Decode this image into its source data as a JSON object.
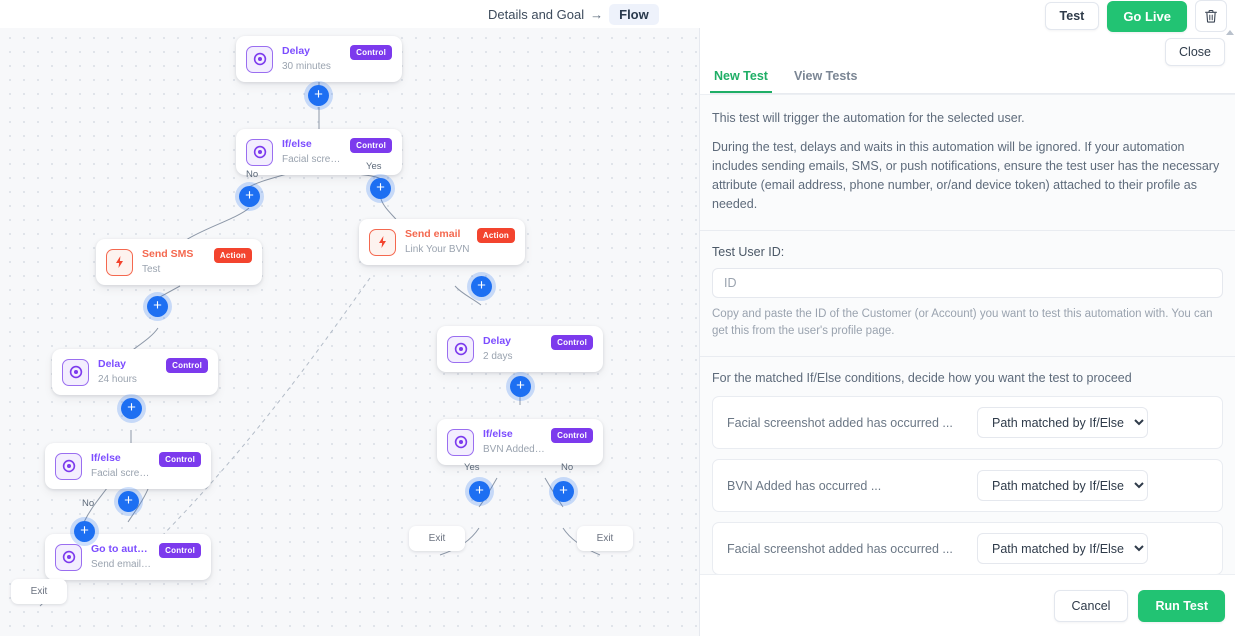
{
  "header": {
    "breadcrumb_first": "Details and Goal",
    "breadcrumb_arrow": "→",
    "breadcrumb_active": "Flow",
    "test_label": "Test",
    "go_live_label": "Go Live",
    "trash_icon": "trash-icon"
  },
  "canvas": {
    "nodes": [
      {
        "title": "Delay",
        "sub": "30 minutes",
        "badge": "Control",
        "kind": "control"
      },
      {
        "title": "If/else",
        "sub": "Facial screenshot added has ...",
        "badge": "Control",
        "kind": "control"
      },
      {
        "title": "Send SMS",
        "sub": "Test",
        "badge": "Action",
        "kind": "action"
      },
      {
        "title": "Send email",
        "sub": "Link Your BVN",
        "badge": "Action",
        "kind": "action"
      },
      {
        "title": "Delay",
        "sub": "24 hours",
        "badge": "Control",
        "kind": "control"
      },
      {
        "title": "If/else",
        "sub": "Facial screenshot added has ...",
        "badge": "Control",
        "kind": "control"
      },
      {
        "title": "Go to automation ...",
        "sub": "Send email ⇒ Link Your BVN",
        "badge": "Control",
        "kind": "control"
      },
      {
        "title": "Delay",
        "sub": "2 days",
        "badge": "Control",
        "kind": "control"
      },
      {
        "title": "If/else",
        "sub": "BVN Added has occurred ...",
        "badge": "Control",
        "kind": "control"
      }
    ],
    "edge_labels": {
      "no1": "No",
      "yes1": "Yes",
      "no2": "No",
      "yes2": "Yes",
      "no3": "No"
    },
    "exit_labels": {
      "left": "Exit",
      "mid": "Exit",
      "right": "Exit"
    },
    "plus_glyph": "+"
  },
  "panel": {
    "close_label": "Close",
    "tabs": [
      {
        "label": "New Test",
        "active": true
      },
      {
        "label": "View Tests",
        "active": false
      }
    ],
    "intro_line1": "This test will trigger the automation for the selected user.",
    "intro_line2": "During the test, delays and waits in this automation will be ignored. If your automation includes sending emails, SMS, or push notifications, ensure the test user has the necessary attribute (email address, phone number, or/and device token) attached to their profile as needed.",
    "user_id_label": "Test User ID:",
    "user_id_value": "",
    "user_id_placeholder": "ID",
    "user_id_helper": "Copy and paste the ID of the Customer (or Account) you want to test this automation with. You can get this from the user's profile page.",
    "conditions_title": "For the matched If/Else conditions, decide how you want the test to proceed",
    "conditions": [
      {
        "label": "Facial screenshot added has occurred ...",
        "selected": "Path matched by If/Else"
      },
      {
        "label": "BVN Added has occurred ...",
        "selected": "Path matched by If/Else"
      },
      {
        "label": "Facial screenshot added has occurred ...",
        "selected": "Path matched by If/Else"
      }
    ],
    "cancel_label": "Cancel",
    "run_test_label": "Run Test"
  },
  "colors": {
    "green": "#22c373",
    "blue": "#1d6ff2",
    "purple": "#7c3aed",
    "red": "#f3442e"
  }
}
